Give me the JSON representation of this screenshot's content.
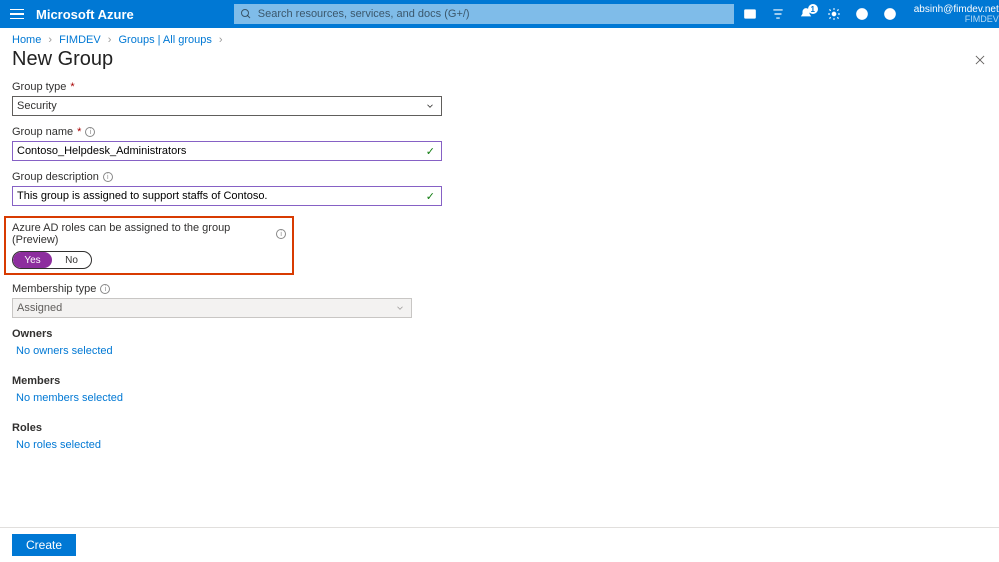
{
  "header": {
    "brand": "Microsoft Azure",
    "search_placeholder": "Search resources, services, and docs (G+/)",
    "notif_count": "1",
    "account_email": "absinh@fimdev.net",
    "account_tenant": "FIMDEV"
  },
  "breadcrumb": {
    "home": "Home",
    "l1": "FIMDEV",
    "l2": "Groups | All groups"
  },
  "title": "New Group",
  "form": {
    "group_type_label": "Group type",
    "group_type_value": "Security",
    "group_name_label": "Group name",
    "group_name_value": "Contoso_Helpdesk_Administrators",
    "group_desc_label": "Group description",
    "group_desc_value": "This group is assigned to support staffs of Contoso.",
    "aad_roles_label": "Azure AD roles can be assigned to the group (Preview)",
    "toggle_yes": "Yes",
    "toggle_no": "No",
    "membership_type_label": "Membership type",
    "membership_type_value": "Assigned",
    "owners_label": "Owners",
    "owners_link": "No owners selected",
    "members_label": "Members",
    "members_link": "No members selected",
    "roles_label": "Roles",
    "roles_link": "No roles selected"
  },
  "footer": {
    "create": "Create"
  }
}
